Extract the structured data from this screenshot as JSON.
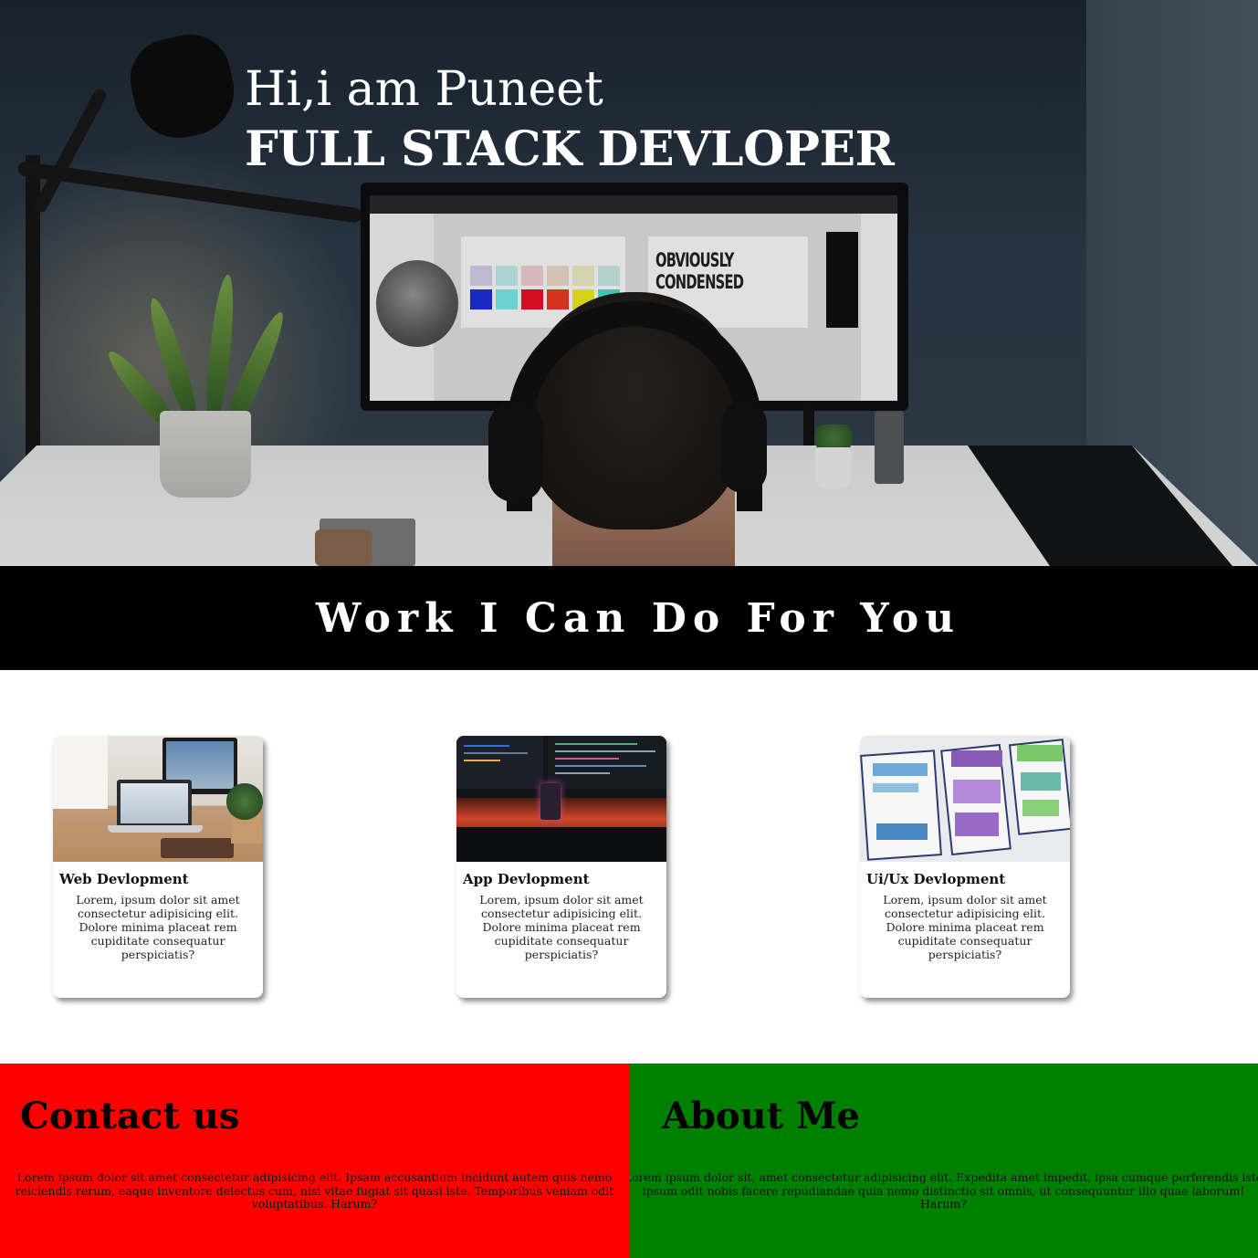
{
  "hero": {
    "greeting": "Hi,i am Puneet",
    "role": "FULL STACK DEVLOPER",
    "screen_text": "OBVIOUSLY CONDENSED"
  },
  "services": {
    "heading": "Work I Can Do For You",
    "cards": [
      {
        "title": "Web Devlopment",
        "description": "Lorem, ipsum dolor sit amet consectetur adipisicing elit. Dolore minima placeat rem cupiditate consequatur perspiciatis?"
      },
      {
        "title": "App Devlopment",
        "description": "Lorem, ipsum dolor sit amet consectetur adipisicing elit. Dolore minima placeat rem cupiditate consequatur perspiciatis?"
      },
      {
        "title": "Ui/Ux Devlopment",
        "description": "Lorem, ipsum dolor sit amet consectetur adipisicing elit. Dolore minima placeat rem cupiditate consequatur perspiciatis?"
      }
    ]
  },
  "contact": {
    "title": "Contact us",
    "text": "Lorem ipsum dolor sit amet consectetur adipisicing elit. Ipsam accusantium incidunt autem quis nemo reiciendis rerum, eaque inventore delectus cum, nisi vitae fugiat sit quasi iste. Temporibus veniam odit voluptatibus. Harum?"
  },
  "about": {
    "title": "About Me",
    "text": "Lorem ipsum dolor sit, amet consectetur adipisicing elit. Expedita amet impedit, ipsa cumque perferendis iste ipsum odit nobis facere repudiandae quia nemo distinctio sit omnis, ut consequuntur illo quae laborum! Harum?"
  },
  "colors": {
    "contact_bg": "#ff0000",
    "about_bg": "#008000",
    "banner_bg": "#000000"
  }
}
